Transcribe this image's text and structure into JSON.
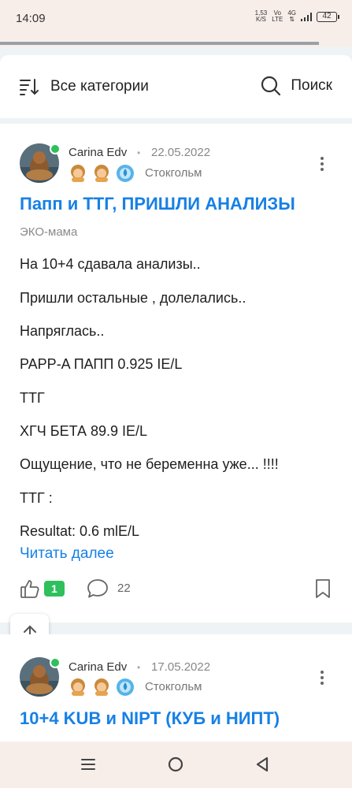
{
  "status": {
    "time": "14:09",
    "speed_value": "1,53",
    "speed_unit": "K/S",
    "volte_top": "Vo",
    "volte_bottom": "LTE",
    "net_top": "4G",
    "net_bottom": "⇅",
    "battery": "42"
  },
  "header": {
    "categories_label": "Все категории",
    "search_label": "Поиск"
  },
  "posts": [
    {
      "author": "Carina Edv",
      "date": "22.05.2022",
      "city": "Стокгольм",
      "badges": [
        "girl-badge-icon",
        "girl-badge-icon",
        "water-badge-icon"
      ],
      "title": "Папп и ТТГ, ПРИШЛИ АНАЛИЗЫ",
      "category": "ЭКО-мама",
      "paragraphs": [
        "На 10+4 сдавала анализы..",
        "Пришли остальные , долелались..",
        "Напряглась..",
        "PAPP-A ПАПП 0.925 IE/L",
        "ТТГ",
        "ХГЧ БЕТА 89.9 IE/L",
        "Ощущение, что не беременна уже... !!!!",
        "ТТГ :",
        "Resultat: 0.6 mlE/L"
      ],
      "read_more": "Читать далее",
      "likes": "1",
      "comments": "22"
    },
    {
      "author": "Carina Edv",
      "date": "17.05.2022",
      "city": "Стокгольм",
      "title": "10+4 KUB и NIPT (КУБ и НИПТ)"
    }
  ],
  "colors": {
    "accent": "#1680e6",
    "like_badge": "#2ec05c",
    "online": "#2ec05c"
  }
}
